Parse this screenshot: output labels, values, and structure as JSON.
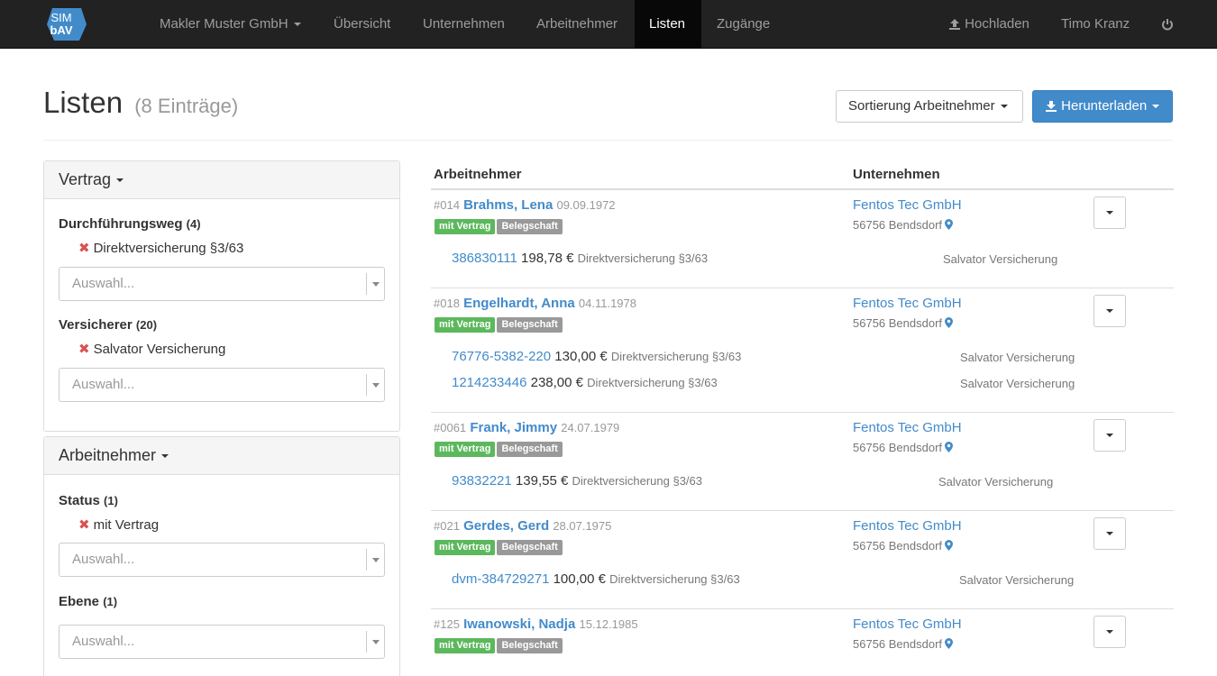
{
  "navbar": {
    "logo_top": "SIM",
    "logo_bottom": "bAV",
    "company_menu": "Makler Muster GmbH",
    "items": [
      "Übersicht",
      "Unternehmen",
      "Arbeitnehmer",
      "Listen",
      "Zugänge"
    ],
    "active": "Listen",
    "upload": "Hochladen",
    "user": "Timo Kranz"
  },
  "header": {
    "title": "Listen",
    "count": "(8 Einträge)",
    "sort_button": "Sortierung Arbeitnehmer",
    "download_button": "Herunterladen"
  },
  "sidebar": {
    "vertrag_panel": {
      "heading": "Vertrag",
      "durchfuehrungsweg_label": "Durchführungsweg",
      "durchfuehrungsweg_count": "(4)",
      "durchfuehrungsweg_selected": "Direktversicherung §3/63",
      "versicherer_label": "Versicherer",
      "versicherer_count": "(20)",
      "versicherer_selected": "Salvator Versicherung",
      "placeholder": "Auswahl..."
    },
    "arbeitnehmer_panel": {
      "heading": "Arbeitnehmer",
      "status_label": "Status",
      "status_count": "(1)",
      "status_selected": "mit Vertrag",
      "ebene_label": "Ebene",
      "ebene_count": "(1)",
      "placeholder": "Auswahl..."
    }
  },
  "table": {
    "col_employee": "Arbeitnehmer",
    "col_company": "Unternehmen",
    "rows": [
      {
        "id": "#014",
        "name": "Brahms, Lena",
        "dob": "09.09.1972",
        "label_contract": "mit Vertrag",
        "label_staff": "Belegschaft",
        "company": "Fentos Tec GmbH",
        "city": "56756 Bendsdorf",
        "contracts": [
          {
            "number": "386830111",
            "amount": "198,78 €",
            "kind": "Direktversicherung §3/63",
            "insurer": "Salvator Versicherung"
          }
        ]
      },
      {
        "id": "#018",
        "name": "Engelhardt, Anna",
        "dob": "04.11.1978",
        "label_contract": "mit Vertrag",
        "label_staff": "Belegschaft",
        "company": "Fentos Tec GmbH",
        "city": "56756 Bendsdorf",
        "contracts": [
          {
            "number": "76776-5382-220",
            "amount": "130,00 €",
            "kind": "Direktversicherung §3/63",
            "insurer": "Salvator Versicherung"
          },
          {
            "number": "1214233446",
            "amount": "238,00 €",
            "kind": "Direktversicherung §3/63",
            "insurer": "Salvator Versicherung"
          }
        ]
      },
      {
        "id": "#0061",
        "name": "Frank, Jimmy",
        "dob": "24.07.1979",
        "label_contract": "mit Vertrag",
        "label_staff": "Belegschaft",
        "company": "Fentos Tec GmbH",
        "city": "56756 Bendsdorf",
        "contracts": [
          {
            "number": "93832221",
            "amount": "139,55 €",
            "kind": "Direktversicherung §3/63",
            "insurer": "Salvator Versicherung"
          }
        ]
      },
      {
        "id": "#021",
        "name": "Gerdes, Gerd",
        "dob": "28.07.1975",
        "label_contract": "mit Vertrag",
        "label_staff": "Belegschaft",
        "company": "Fentos Tec GmbH",
        "city": "56756 Bendsdorf",
        "contracts": [
          {
            "number": "dvm-384729271",
            "amount": "100,00 €",
            "kind": "Direktversicherung §3/63",
            "insurer": "Salvator Versicherung"
          }
        ]
      },
      {
        "id": "#125",
        "name": "Iwanowski, Nadja",
        "dob": "15.12.1985",
        "label_contract": "mit Vertrag",
        "label_staff": "Belegschaft",
        "company": "Fentos Tec GmbH",
        "city": "56756 Bendsdorf",
        "contracts": []
      }
    ]
  },
  "colors": {
    "navbar_bg": "#222222",
    "link": "#428bca",
    "primary": "#428bca",
    "success": "#5cb85c",
    "danger": "#d9534f"
  }
}
